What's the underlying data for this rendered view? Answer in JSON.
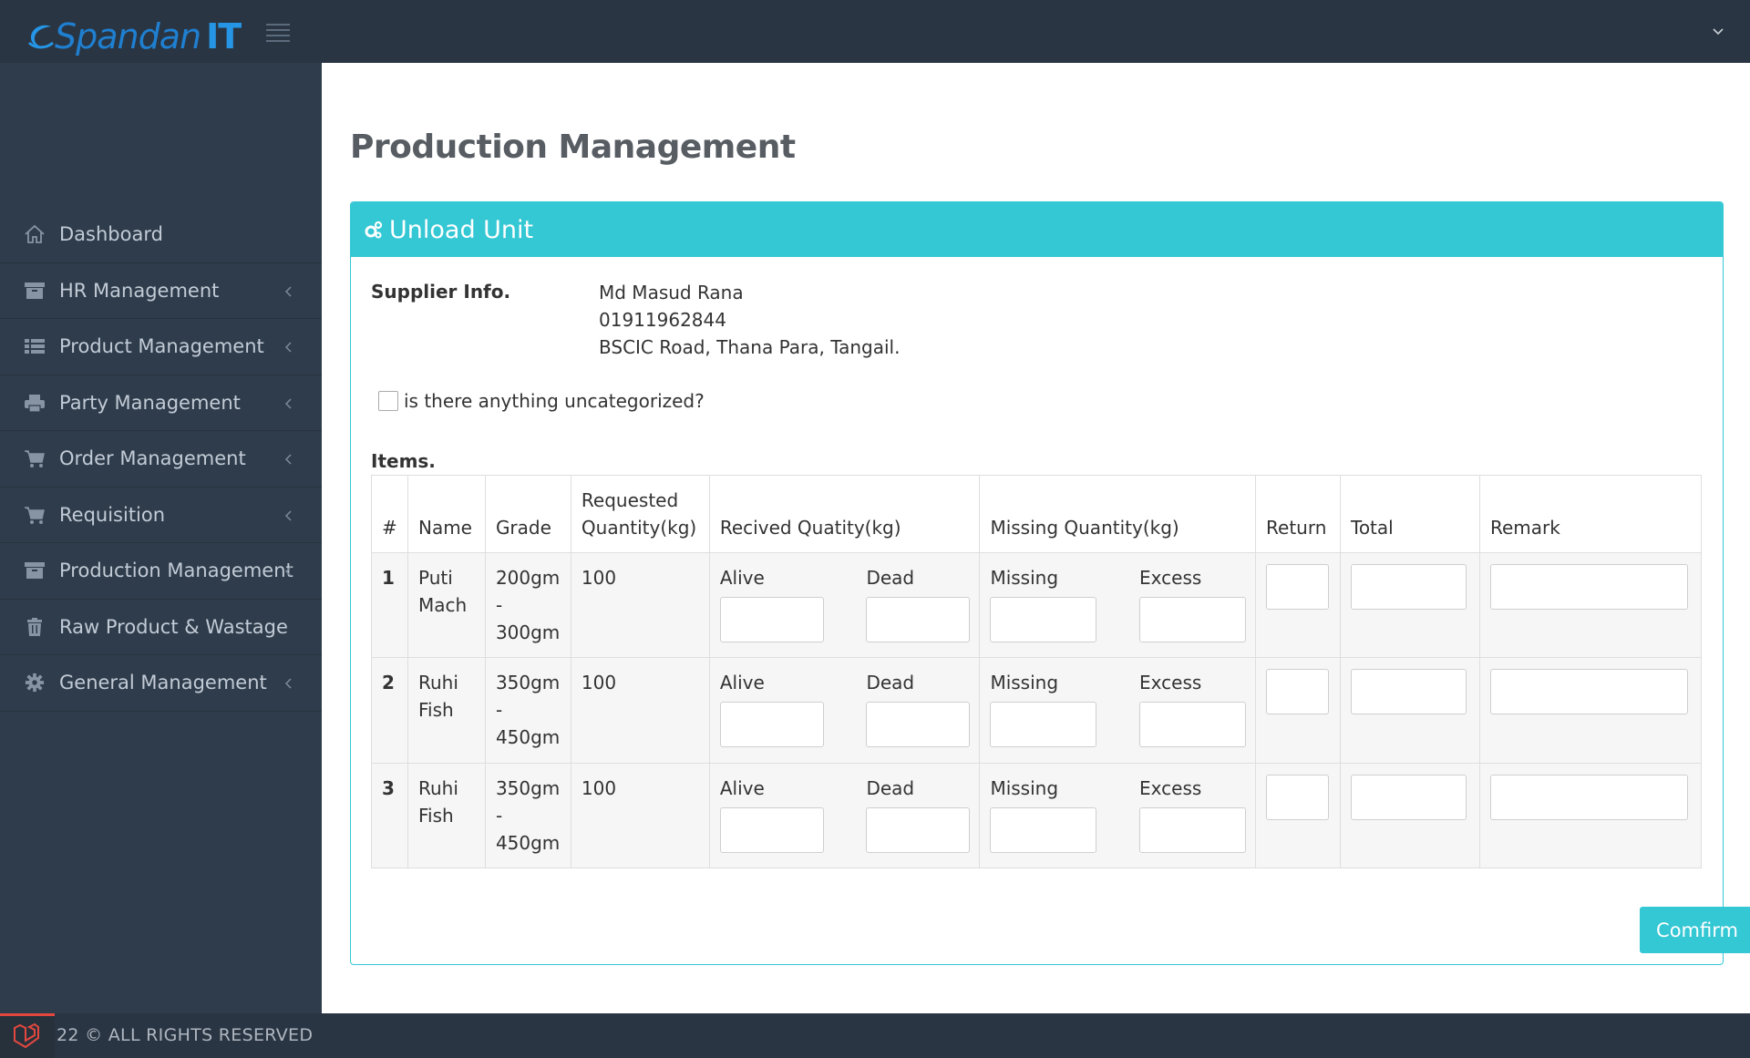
{
  "brand": {
    "name_prefix": "Spandan",
    "name_suffix": "IT"
  },
  "sidebar": {
    "items": [
      {
        "label": "Dashboard",
        "icon": "home-icon",
        "has_submenu": false
      },
      {
        "label": "HR Management",
        "icon": "archive-icon",
        "has_submenu": true
      },
      {
        "label": "Product Management",
        "icon": "list-icon",
        "has_submenu": true
      },
      {
        "label": "Party Management",
        "icon": "printer-icon",
        "has_submenu": true
      },
      {
        "label": "Order Management",
        "icon": "cart-icon",
        "has_submenu": true
      },
      {
        "label": "Requisition",
        "icon": "cart-icon",
        "has_submenu": true
      },
      {
        "label": "Production Management",
        "icon": "archive-icon",
        "has_submenu": true
      },
      {
        "label": "Raw Product & Wastage",
        "icon": "trash-icon",
        "has_submenu": false
      },
      {
        "label": "General Management",
        "icon": "gear-icon",
        "has_submenu": true
      }
    ]
  },
  "page": {
    "title": "Production Management"
  },
  "panel": {
    "title": "Unload Unit",
    "supplier_label": "Supplier Info.",
    "supplier_name": "Md Masud Rana",
    "supplier_phone": "01911962844",
    "supplier_address": "BSCIC Road, Thana Para, Tangail.",
    "uncategorized_label": "is there anything uncategorized?",
    "items_label": "Items.",
    "confirm_label": "Comfirm"
  },
  "table": {
    "headers": {
      "num": "#",
      "name": "Name",
      "grade": "Grade",
      "requested": "Requested Quantity(kg)",
      "received": "Recived Quatity(kg)",
      "missing": "Missing Quantity(kg)",
      "return": "Return",
      "total": "Total",
      "remark": "Remark"
    },
    "sub_labels": {
      "alive": "Alive",
      "dead": "Dead",
      "missing": "Missing",
      "excess": "Excess"
    },
    "rows": [
      {
        "idx": "1",
        "name": "Puti Mach",
        "grade": "200gm - 300gm",
        "requested": "100"
      },
      {
        "idx": "2",
        "name": "Ruhi Fish",
        "grade": "350gm - 450gm",
        "requested": "100"
      },
      {
        "idx": "3",
        "name": "Ruhi Fish",
        "grade": "350gm - 450gm",
        "requested": "100"
      }
    ]
  },
  "footer": {
    "text": "22 © ALL RIGHTS RESERVED"
  },
  "colors": {
    "accent": "#34c7d4",
    "sidebar": "#2f3c4b",
    "topbar": "#2a3543"
  }
}
